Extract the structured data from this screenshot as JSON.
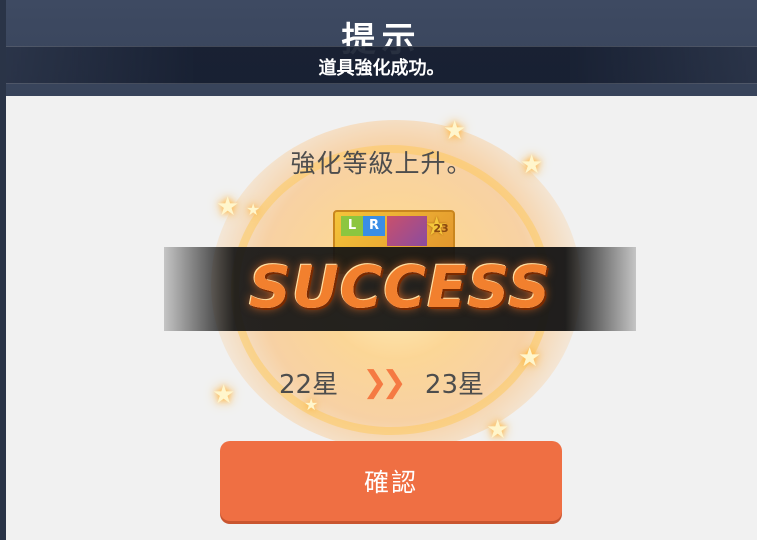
{
  "dialog": {
    "title": "提示",
    "toast": "道具強化成功。",
    "message": "強化等級上升。",
    "result_banner": "SUCCESS",
    "item": {
      "rarity_letters": [
        "L",
        "R"
      ],
      "star_count": "23"
    },
    "star_change": {
      "from": "22星",
      "arrow": "❯❯",
      "to": "23星"
    },
    "confirm_label": "確認"
  },
  "colors": {
    "header_bg": "#3e4a62",
    "dialog_bg": "#f1f1f1",
    "accent_orange": "#ef6f43",
    "text_gray": "#4d4d4d"
  }
}
